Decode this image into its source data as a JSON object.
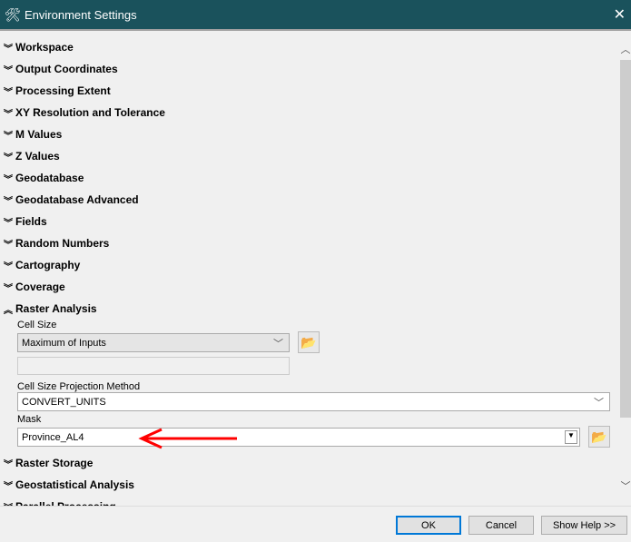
{
  "window": {
    "title": "Environment Settings",
    "icon": "tools-icon"
  },
  "sections_top": [
    "Workspace",
    "Output Coordinates",
    "Processing Extent",
    "XY Resolution and Tolerance",
    "M Values",
    "Z Values",
    "Geodatabase",
    "Geodatabase Advanced",
    "Fields",
    "Random Numbers",
    "Cartography",
    "Coverage"
  ],
  "raster_analysis": {
    "title": "Raster Analysis",
    "cell_size_label": "Cell Size",
    "cell_size_value": "Maximum of Inputs",
    "cell_size_text": "",
    "projection_label": "Cell Size Projection Method",
    "projection_value": "CONVERT_UNITS",
    "mask_label": "Mask",
    "mask_value": "Province_AL4"
  },
  "sections_bottom": [
    "Raster Storage",
    "Geostatistical Analysis",
    "Parallel Processing"
  ],
  "buttons": {
    "ok": "OK",
    "cancel": "Cancel",
    "help": "Show Help >>"
  },
  "colors": {
    "title_bar": "#1a525c",
    "annotation_arrow": "#ff0000"
  }
}
